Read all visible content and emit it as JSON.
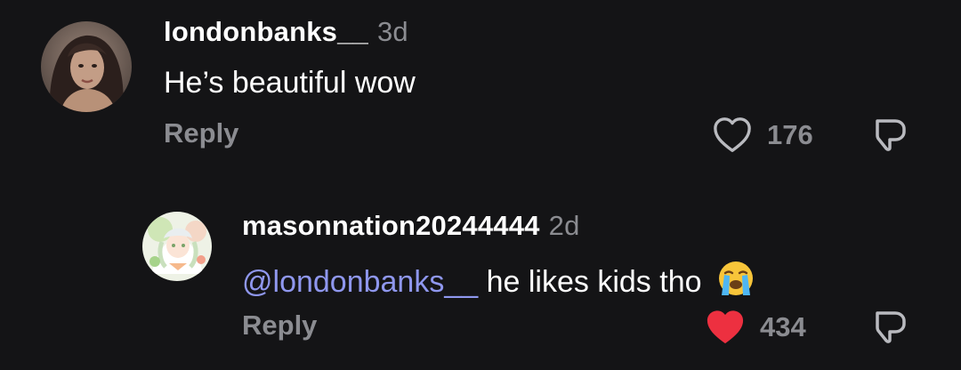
{
  "comments": [
    {
      "username": "londonbanks__",
      "time": "3d",
      "text": "He’s beautiful wow",
      "reply_label": "Reply",
      "like_count": "176",
      "liked": false
    },
    {
      "username": "masonnation20244444",
      "time": "2d",
      "mention": "londonbanks__",
      "text": " he likes kids tho",
      "emoji": "loudly-crying-face",
      "reply_label": "Reply",
      "like_count": "434",
      "liked": true
    }
  ],
  "colors": {
    "background": "#141416",
    "muted": "#8b8c91",
    "mention": "#8f97ee",
    "liked_heart": "#ed3040"
  },
  "icons": {
    "like": "heart-icon",
    "dislike": "dislike-icon"
  }
}
